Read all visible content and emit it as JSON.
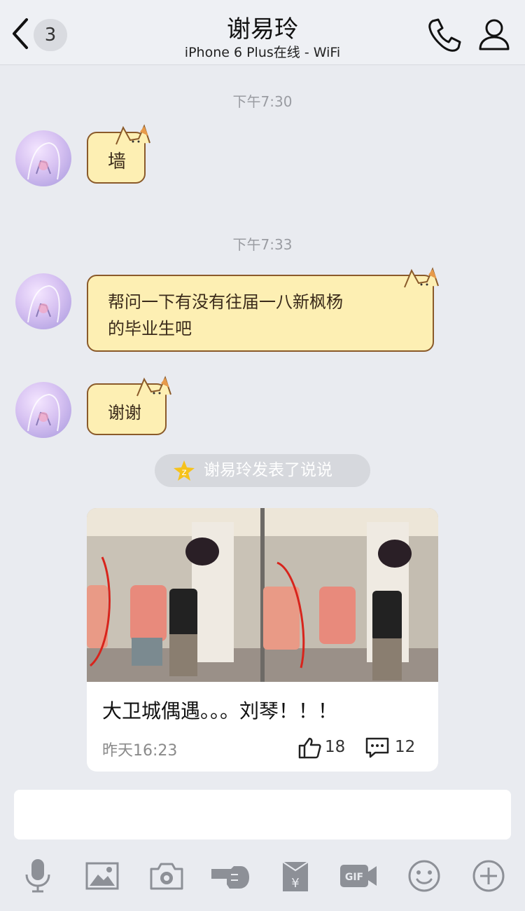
{
  "header": {
    "back_count": "3",
    "title": "谢易玲",
    "subtitle": "iPhone 6 Plus在线 - WiFi"
  },
  "messages": [
    {
      "time": "下午7:30",
      "text": "墙"
    },
    {
      "time": "下午7:33",
      "lines": [
        "帮问一下有没有往届一八新枫杨",
        "的毕业生吧"
      ]
    },
    {
      "text": "谢谢"
    }
  ],
  "qzone_notice": "谢易玲发表了说说",
  "card": {
    "text": "大卫城偶遇。。。刘琴！！！",
    "time": "昨天16:23",
    "likes": "18",
    "comments": "12"
  },
  "input": {
    "placeholder": ""
  },
  "toolbar": [
    "mic-icon",
    "image-icon",
    "camera-icon",
    "poke-icon",
    "red-packet-icon",
    "gif-icon",
    "emoji-icon",
    "add-icon"
  ],
  "colors": {
    "background": "#e9ebf0",
    "bubble": "#fdefb3",
    "bubble_border": "#8a5a2a",
    "star": "#f6c21b"
  }
}
